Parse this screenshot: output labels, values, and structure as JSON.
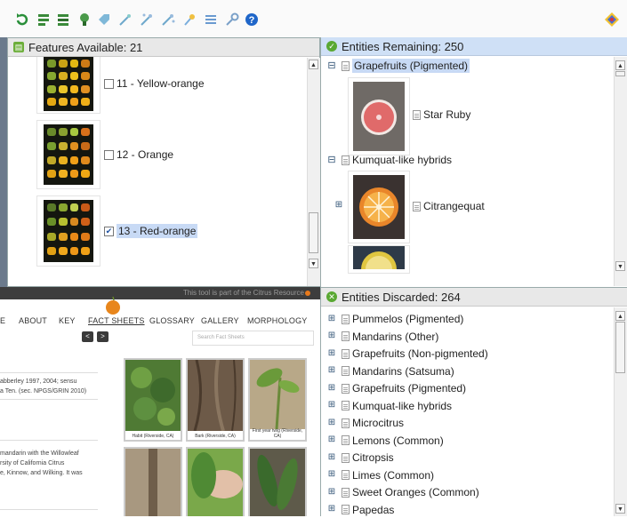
{
  "toolbar": {
    "icons": [
      "restart-icon",
      "features-icon",
      "features-best-icon",
      "entities-icon",
      "tag-icon",
      "wand-icon",
      "wand-all-icon",
      "wand-filter-icon",
      "pin-icon",
      "list-icon",
      "key-icon",
      "help-icon",
      "app-logo-icon"
    ]
  },
  "features": {
    "header": "Features Available: 21",
    "items": [
      {
        "label": "11 - Yellow-orange",
        "checked": false
      },
      {
        "label": "12 - Orange",
        "checked": false
      },
      {
        "label": "13 - Red-orange",
        "checked": true
      }
    ],
    "check_mark": "✔"
  },
  "remaining": {
    "header": "Entities Remaining: 250",
    "groups": [
      {
        "label": "Grapefruits (Pigmented)",
        "expander": "⊟"
      },
      {
        "label": "Kumquat-like hybrids",
        "expander": "⊟"
      }
    ],
    "entities": [
      {
        "label": "Star Ruby"
      },
      {
        "label": "Citrangequat",
        "expander": "⊞"
      }
    ]
  },
  "discarded": {
    "header": "Entities Discarded: 264",
    "items": [
      "Pummelos (Pigmented)",
      "Mandarins (Other)",
      "Grapefruits (Non-pigmented)",
      "Mandarins (Satsuma)",
      "Grapefruits (Pigmented)",
      "Kumquat-like hybrids",
      "Microcitrus",
      "Lemons (Common)",
      "Citropsis",
      "Limes (Common)",
      "Sweet Oranges (Common)",
      "Papedas"
    ],
    "expander": "⊞"
  },
  "website": {
    "banner": "This tool is part of the Citrus Resource",
    "nav": [
      "HOME",
      "ABOUT",
      "KEY",
      "FACT SHEETS",
      "GLOSSARY",
      "GALLERY",
      "MORPHOLOGY"
    ],
    "nav_visible": [
      "E",
      "ABOUT",
      "KEY",
      "FACT SHEETS",
      "GLOSSARY",
      "GALLERY",
      "MORPHOLOGY"
    ],
    "prev": "<",
    "next": ">",
    "search_placeholder": "Search Fact Sheets",
    "text1": [
      "abberley 1997, 2004; sensu",
      "a Ten. (sec. NPGS/GRIN 2010)"
    ],
    "text2": [
      " mandarin with the Willowleaf",
      "rsity of California Citrus",
      "e, Kinnow, and Wilking. It was"
    ],
    "captions": [
      "Habit (Riverside, CA)",
      "Bark (Riverside, CA)",
      "First year twig (Riverside, CA)"
    ]
  },
  "colors": {
    "accent_blue": "#c8daf5",
    "remaining_header": "#cfe0f6",
    "orange": "#e87a1c"
  }
}
